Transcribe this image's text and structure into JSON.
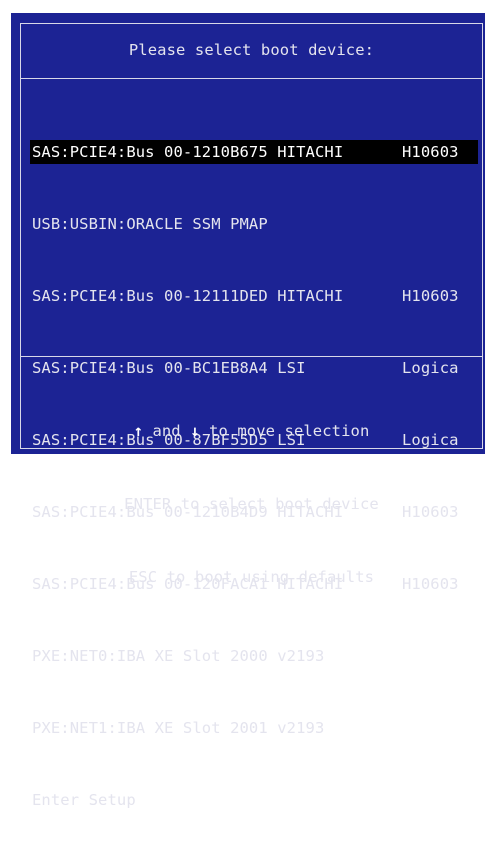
{
  "header": {
    "title": "Please select boot device:"
  },
  "devices": [
    {
      "name": "SAS:PCIE4:Bus 00-1210B675 HITACHI",
      "vendor": "H10603",
      "selected": true
    },
    {
      "name": "USB:USBIN:ORACLE SSM PMAP",
      "vendor": "",
      "selected": false
    },
    {
      "name": "SAS:PCIE4:Bus 00-12111DED HITACHI",
      "vendor": "H10603",
      "selected": false
    },
    {
      "name": "SAS:PCIE4:Bus 00-BC1EB8A4 LSI",
      "vendor": "Logica",
      "selected": false
    },
    {
      "name": "SAS:PCIE4:Bus 00-87BF55D5 LSI",
      "vendor": "Logica",
      "selected": false
    },
    {
      "name": "SAS:PCIE4:Bus 00-1210B4D9 HITACHI",
      "vendor": "H10603",
      "selected": false
    },
    {
      "name": "SAS:PCIE4:Bus 00-120FACA1 HITACHI",
      "vendor": "H10603",
      "selected": false
    },
    {
      "name": "PXE:NET0:IBA XE Slot 2000 v2193",
      "vendor": "",
      "selected": false
    },
    {
      "name": "PXE:NET1:IBA XE Slot 2001 v2193",
      "vendor": "",
      "selected": false
    },
    {
      "name": "Enter Setup",
      "vendor": "",
      "selected": false
    }
  ],
  "footer": {
    "up_arrow": "↑",
    "and_text": " and ",
    "down_arrow": "↓",
    "move_text": " to move selection",
    "enter_text": "ENTER to select boot device",
    "esc_text": "ESC to boot using defaults"
  },
  "colors": {
    "background": "#1c2394",
    "text": "#e4e4ee",
    "selection_bg": "#000000"
  }
}
